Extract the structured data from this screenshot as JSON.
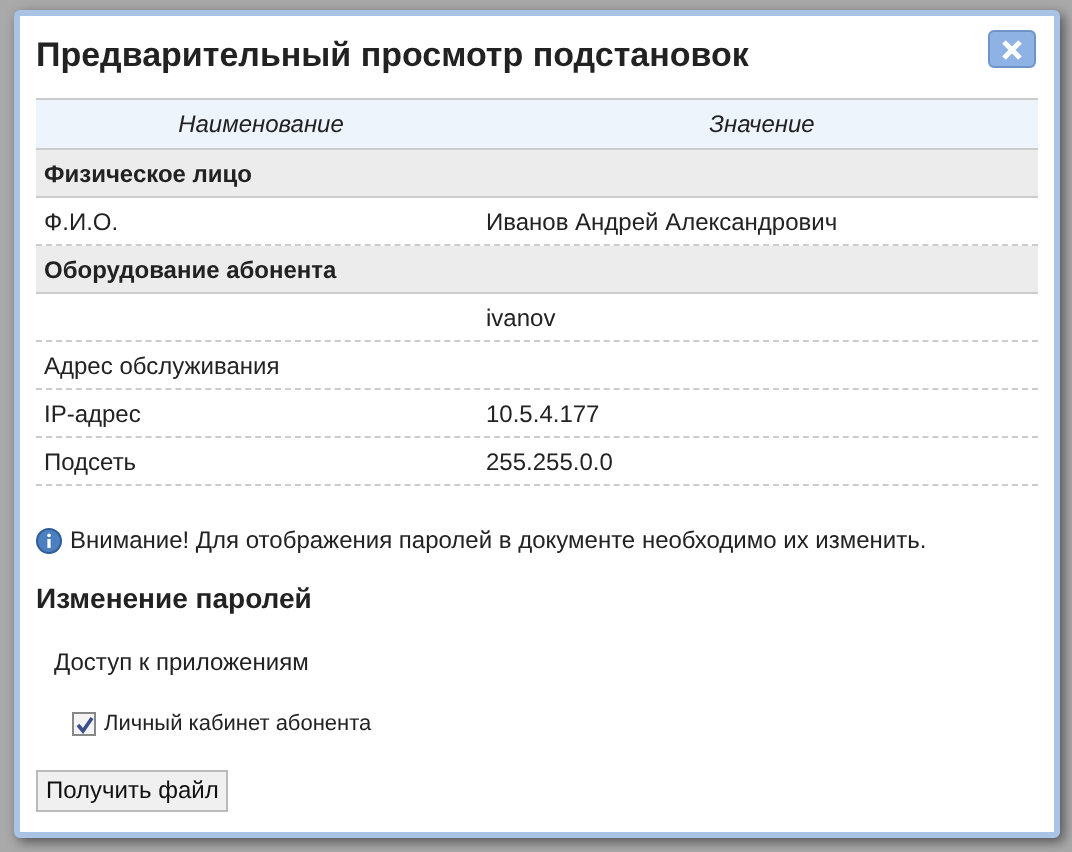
{
  "dialog": {
    "title": "Предварительный просмотр подстановок"
  },
  "table": {
    "columns": [
      "Наименование",
      "Значение"
    ],
    "rows": [
      {
        "kind": "group",
        "name": "Физическое лицо"
      },
      {
        "kind": "row",
        "name": "Ф.И.О.",
        "value": "Иванов Андрей Александрович"
      },
      {
        "kind": "group",
        "name": "Оборудование абонента"
      },
      {
        "kind": "row",
        "value": "ivanov"
      },
      {
        "kind": "row",
        "name": "Адрес обслуживания"
      },
      {
        "kind": "row",
        "name": "IP-адрес",
        "value": "10.5.4.177"
      },
      {
        "kind": "row",
        "name": "Подсеть",
        "value": "255.255.0.0"
      }
    ]
  },
  "notice": "Внимание! Для отображения паролей в документе необходимо их изменить.",
  "passwords": {
    "heading": "Изменение паролей",
    "subheading": "Доступ к приложениям",
    "options": [
      {
        "label": "Личный кабинет абонента",
        "checked": true
      }
    ]
  },
  "button": "Получить файл"
}
